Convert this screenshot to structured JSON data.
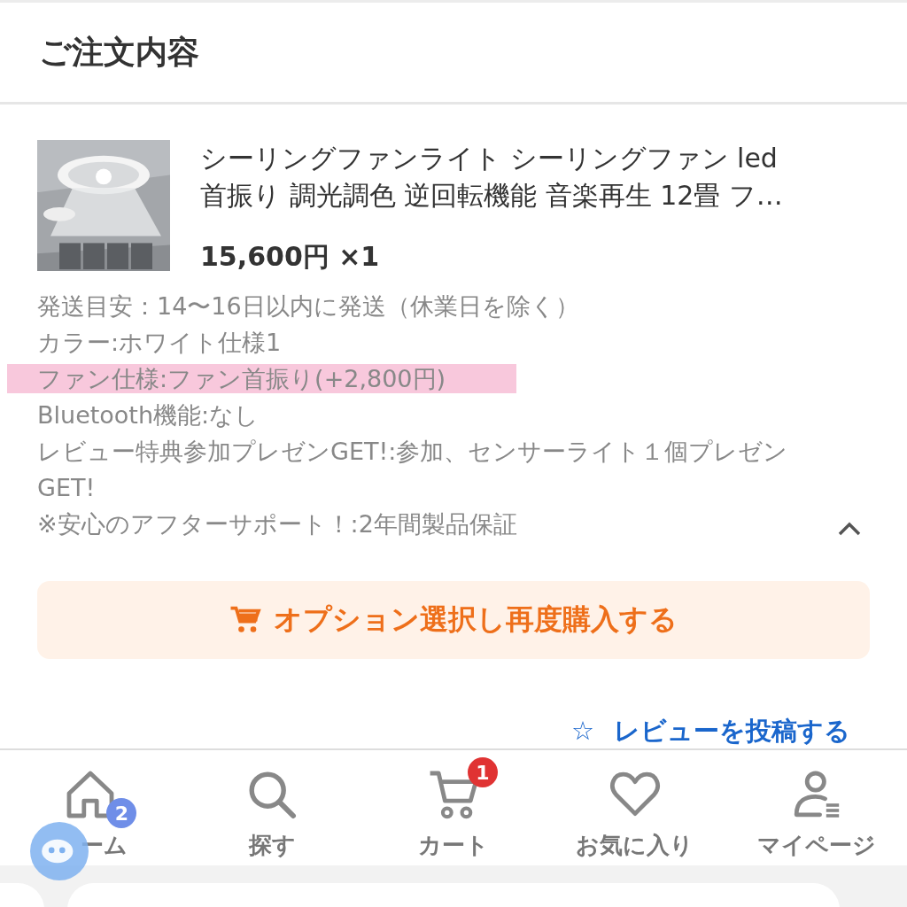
{
  "header": {
    "title": "ご注文内容"
  },
  "item": {
    "title_lines": [
      "シーリングファンライト シーリングファン led",
      "首振り 調光調色 逆回転機能 音楽再生 12畳 フ…"
    ],
    "price": "15,600円 ×1",
    "details": [
      {
        "text": "発送目安：14〜16日以内に発送（休業日を除く）",
        "highlighted": false
      },
      {
        "text": "カラー:ホワイト仕様1",
        "highlighted": false
      },
      {
        "text": "ファン仕様:ファン首振り(+2,800円)",
        "highlighted": true
      },
      {
        "text": "Bluetooth機能:なし",
        "highlighted": false
      },
      {
        "text": "レビュー特典参加プレゼンGET!:参加、センサーライト１個プレゼンGET!",
        "highlighted": false
      },
      {
        "text": "※安心のアフターサポート！:2年間製品保証",
        "highlighted": false
      }
    ],
    "expanded": true
  },
  "rebuy_button": {
    "label": "オプション選択し再度購入する"
  },
  "review_link": {
    "icon": "☆",
    "label": "レビューを投稿する"
  },
  "tab_bar": [
    {
      "kind": "home",
      "label": "ーム",
      "badge": "2"
    },
    {
      "kind": "search",
      "label": "探す"
    },
    {
      "kind": "cart",
      "label": "カート",
      "badge": "1"
    },
    {
      "kind": "heart",
      "label": "お気に入り"
    },
    {
      "kind": "user",
      "label": "マイページ"
    }
  ]
}
